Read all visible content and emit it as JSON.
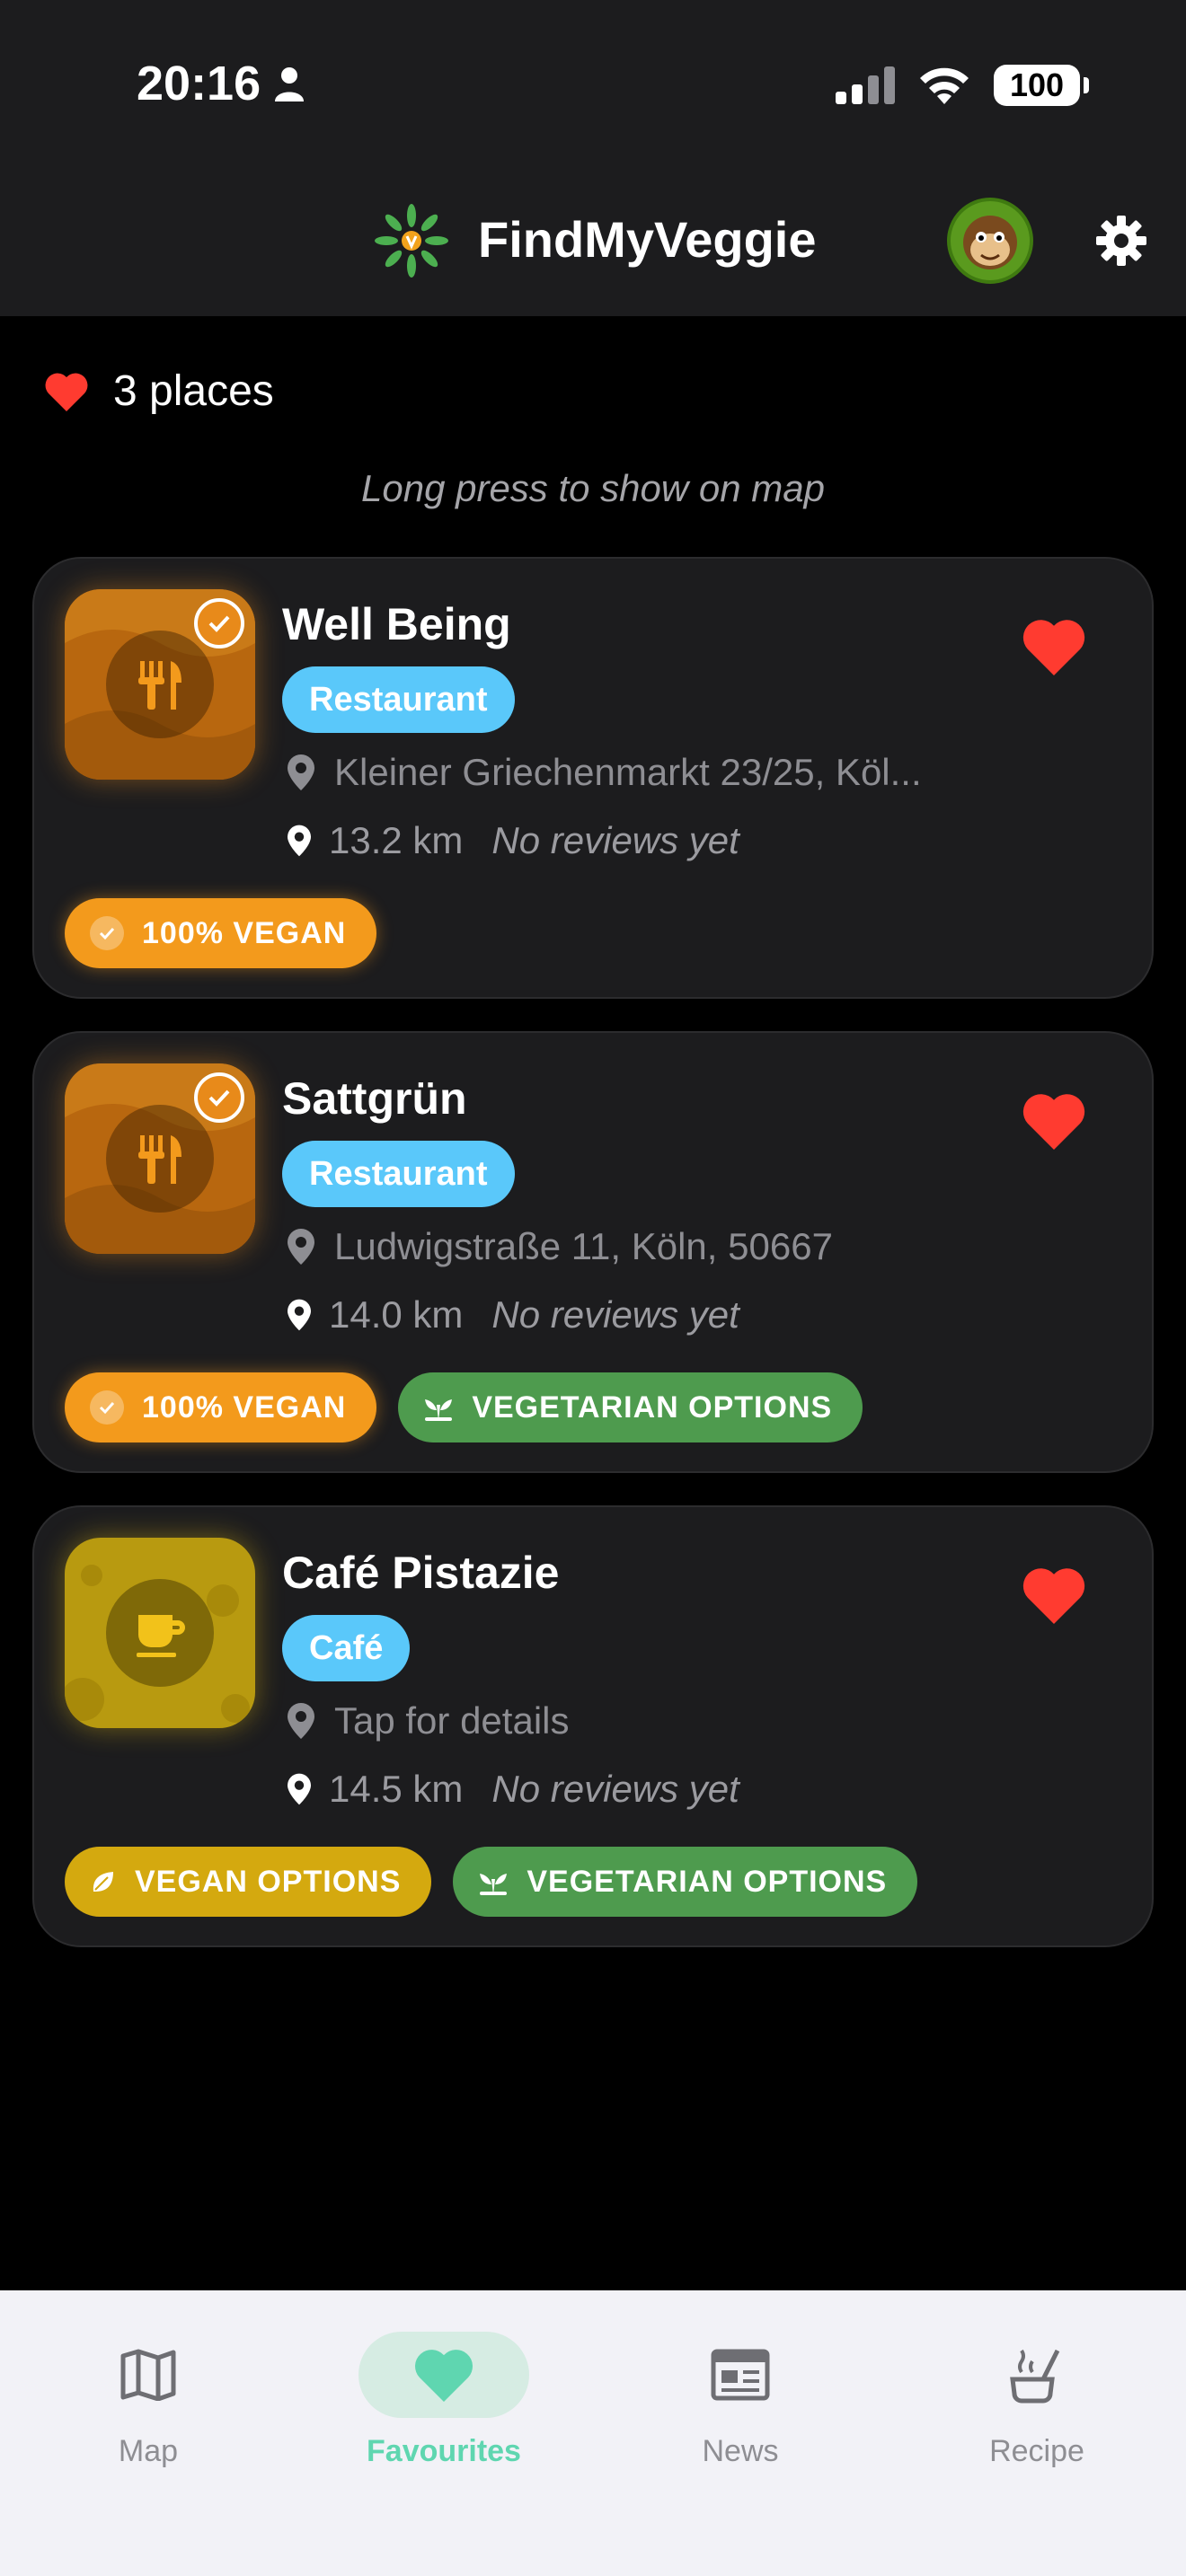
{
  "status": {
    "time": "20:16",
    "battery": "100"
  },
  "header": {
    "title": "FindMyVeggie"
  },
  "favourites": {
    "count_label": "3 places",
    "hint": "Long press to show on map"
  },
  "places": [
    {
      "name": "Well Being",
      "type": "Restaurant",
      "address": "Kleiner Griechenmarkt 23/25, Köl...",
      "distance": "13.2 km",
      "reviews": "No reviews yet",
      "tags": [
        "100% VEGAN"
      ]
    },
    {
      "name": "Sattgrün",
      "type": "Restaurant",
      "address": "Ludwigstraße 11, Köln, 50667",
      "distance": "14.0 km",
      "reviews": "No reviews yet",
      "tags": [
        "100% VEGAN",
        "VEGETARIAN OPTIONS"
      ]
    },
    {
      "name": "Café Pistazie",
      "type": "Café",
      "address": "Tap for details",
      "distance": "14.5 km",
      "reviews": "No reviews yet",
      "tags": [
        "VEGAN OPTIONS",
        "VEGETARIAN OPTIONS"
      ]
    }
  ],
  "tabs": [
    {
      "label": "Map"
    },
    {
      "label": "Favourites"
    },
    {
      "label": "News"
    },
    {
      "label": "Recipe"
    }
  ],
  "colors": {
    "accent": "#5fd6b0",
    "heart": "#ff3b30",
    "pill": "#5ac8fa",
    "vegan100": "#f39a1c",
    "vegetarian": "#4e9b4e",
    "veganOptions": "#d4a90f"
  }
}
